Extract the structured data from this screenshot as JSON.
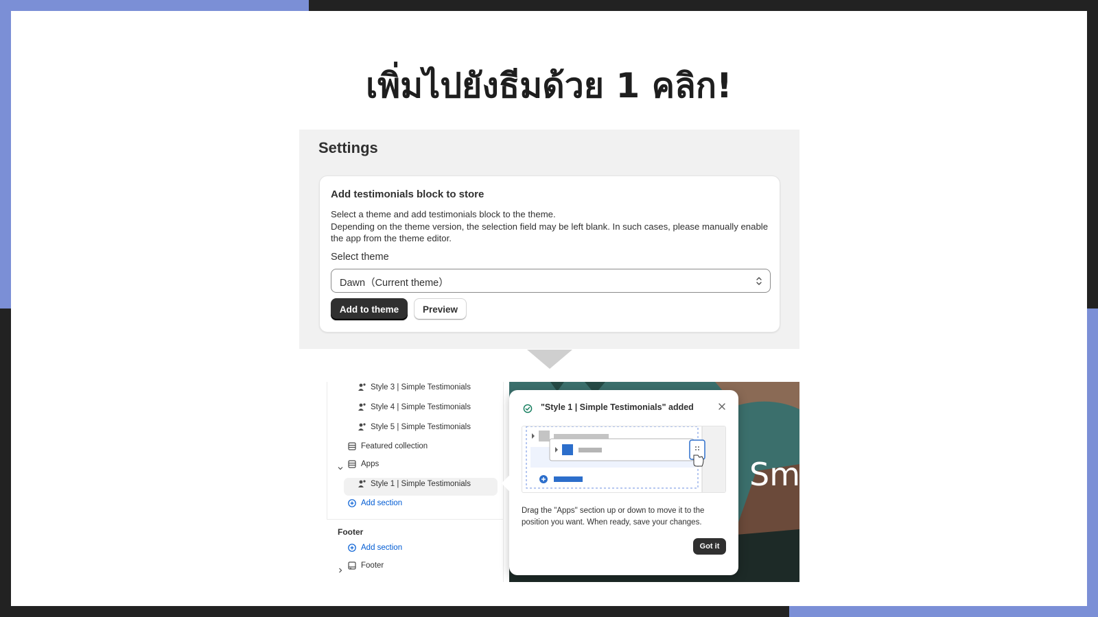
{
  "headline": "เพิ่มไปยังธีมด้วย 1 คลิก!",
  "settings": {
    "title": "Settings",
    "card": {
      "title": "Add testimonials block to store",
      "desc_line1": "Select a theme and add testimonials block to the theme.",
      "desc_line2": "Depending on the theme version, the selection field may be left blank. In such cases, please manually enable the app from the theme editor.",
      "select_label": "Select theme",
      "select_value": "Dawn（Current theme）",
      "add_button": "Add to theme",
      "preview_button": "Preview"
    }
  },
  "editor": {
    "tree": {
      "style3": "Style 3 | Simple Testimonials",
      "style4": "Style 4 | Simple Testimonials",
      "style5": "Style 5 | Simple Testimonials",
      "featured": "Featured collection",
      "apps": "Apps",
      "apps_child": "Style 1 | Simple Testimonials",
      "add_section_1": "Add section",
      "footer_heading": "Footer",
      "add_section_2": "Add section",
      "footer_item": "Footer"
    },
    "canvas_text": "Sma",
    "popover": {
      "title": "\"Style 1 | Simple Testimonials\" added",
      "desc": "Drag the \"Apps\" section up or down to move it to the position you want. When ready, save your changes.",
      "button": "Got it"
    }
  },
  "colors": {
    "accent": "#7b8fd6",
    "dark": "#303030",
    "link": "#005bd3",
    "success": "#0f7a5a"
  }
}
